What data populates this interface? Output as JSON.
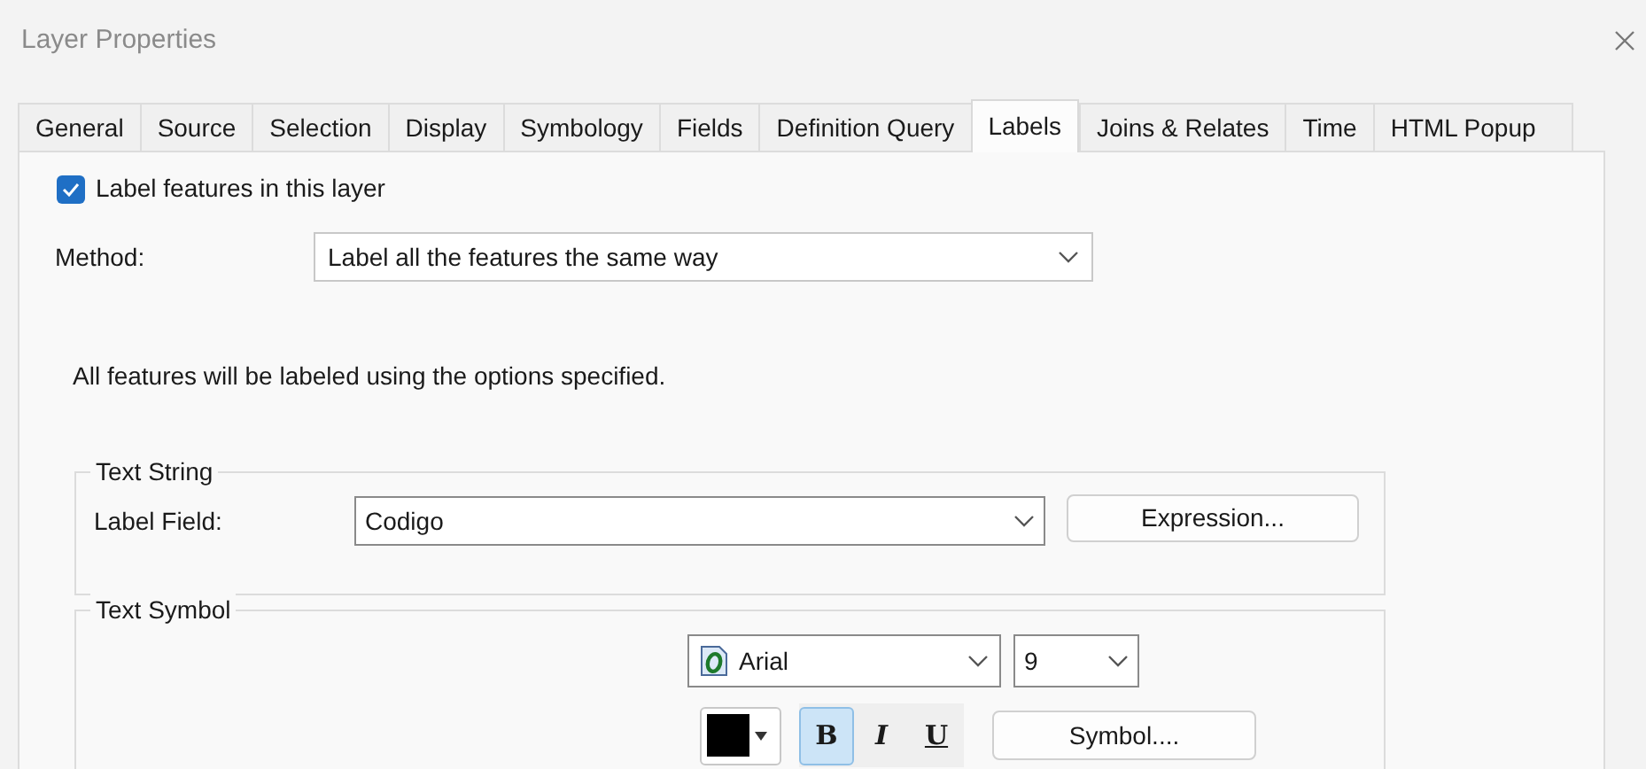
{
  "window": {
    "title": "Layer Properties"
  },
  "tabs": [
    {
      "label": "General",
      "selected": false
    },
    {
      "label": "Source",
      "selected": false
    },
    {
      "label": "Selection",
      "selected": false
    },
    {
      "label": "Display",
      "selected": false
    },
    {
      "label": "Symbology",
      "selected": false
    },
    {
      "label": "Fields",
      "selected": false
    },
    {
      "label": "Definition Query",
      "selected": false
    },
    {
      "label": "Labels",
      "selected": true
    },
    {
      "label": "Joins & Relates",
      "selected": false
    },
    {
      "label": "Time",
      "selected": false
    },
    {
      "label": "HTML Popup",
      "selected": false
    }
  ],
  "label_features": {
    "label": "Label features in this layer",
    "checked": true
  },
  "method": {
    "label": "Method:",
    "value": "Label all the features the same way"
  },
  "info": "All features will be labeled using the options specified.",
  "text_string": {
    "title": "Text String",
    "field_label": "Label Field:",
    "field_value": "Codigo",
    "expression_button": "Expression..."
  },
  "text_symbol": {
    "title": "Text Symbol",
    "font": "Arial",
    "size": "9",
    "color": "#000000",
    "styles": [
      {
        "label": "B",
        "selected": true
      },
      {
        "label": "I",
        "selected": false
      },
      {
        "label": "U",
        "selected": false
      }
    ],
    "symbol_button": "Symbol...."
  }
}
